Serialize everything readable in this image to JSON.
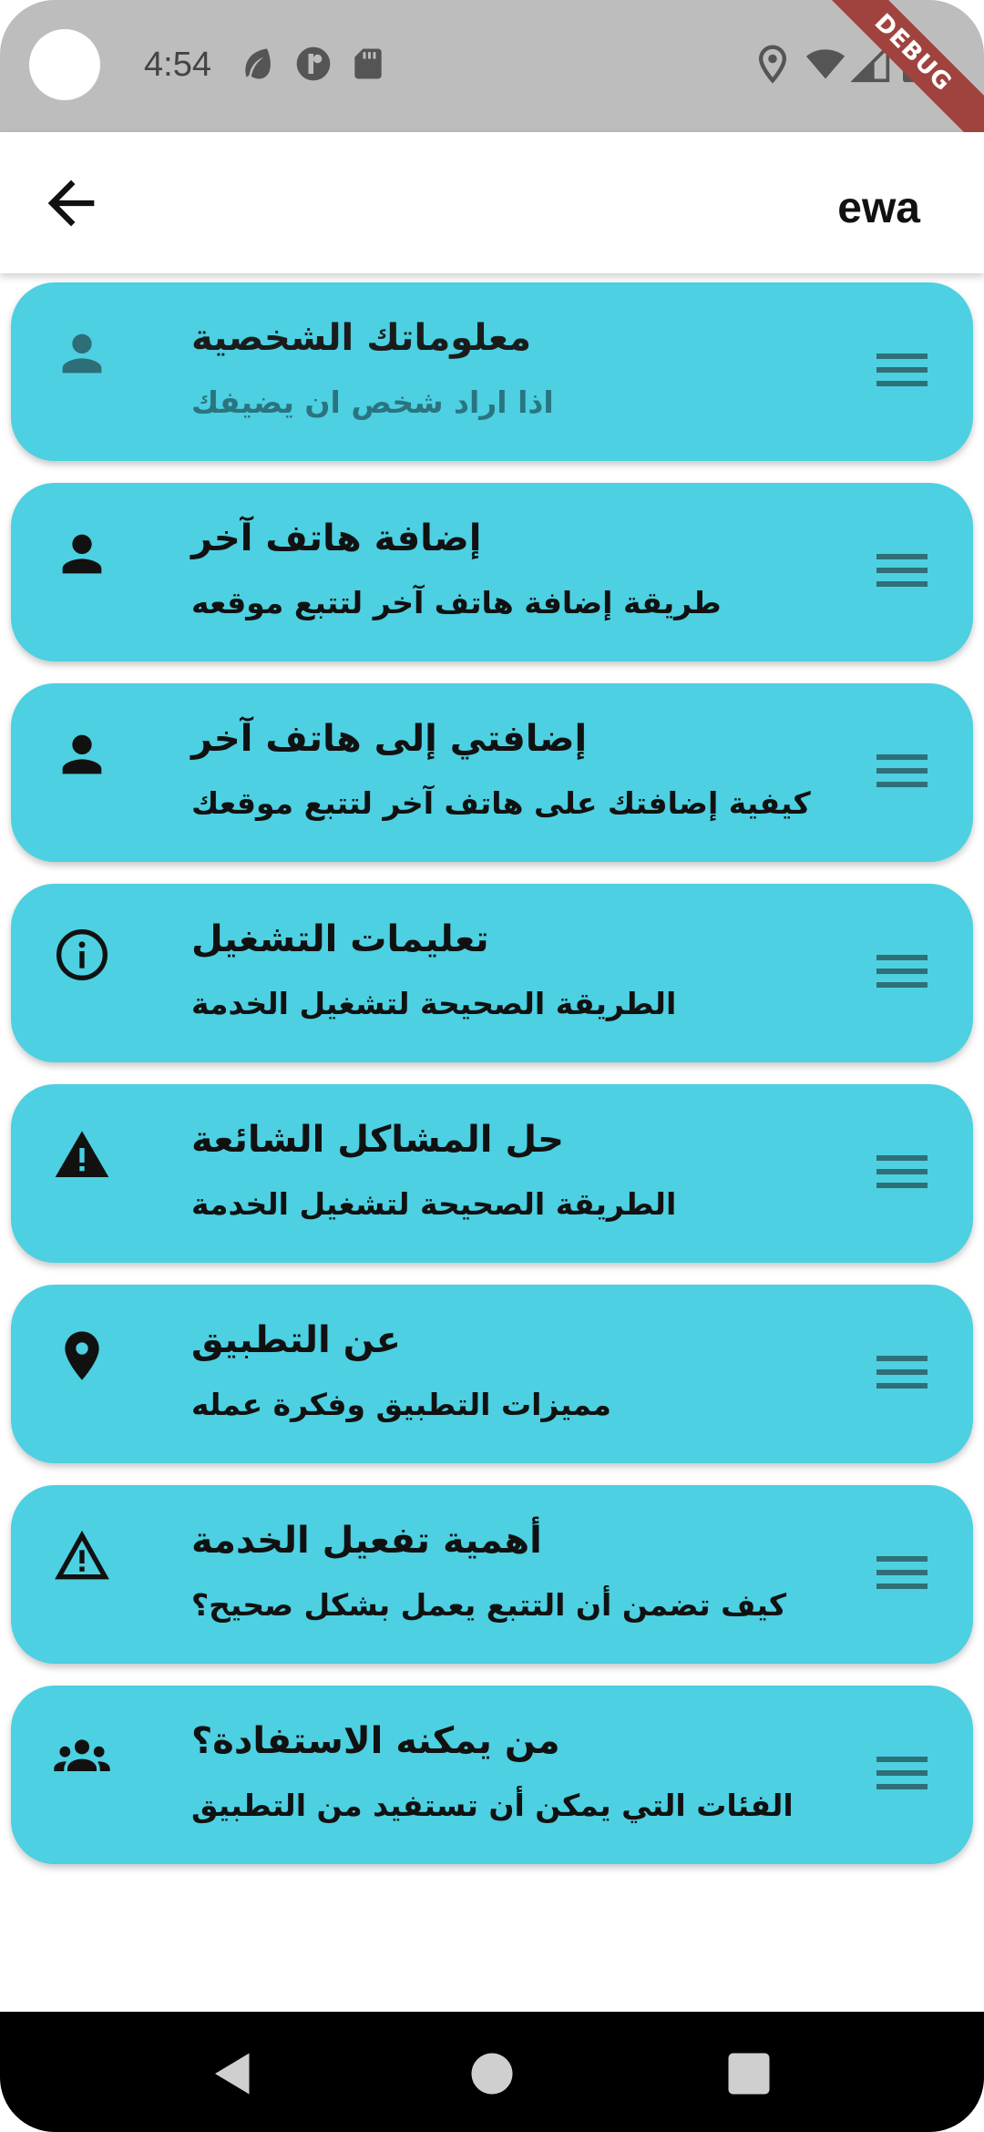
{
  "status_bar": {
    "time": "4:54",
    "debug_label": "DEBUG",
    "left_icons": [
      "leaf-icon",
      "app-circle-icon",
      "sd-card-icon"
    ],
    "right_icons": [
      "location-icon",
      "wifi-icon",
      "signal-icon",
      "battery-icon"
    ]
  },
  "app_bar": {
    "title": "ewa",
    "back_icon": "arrow-back-icon"
  },
  "colors": {
    "card_bg": "#4dd0e1",
    "muted_subtitle": "#2a7480",
    "status_bar_bg": "#bdbdbd",
    "debug_ribbon": "#a0433f"
  },
  "items": [
    {
      "title": "معلوماتك الشخصية",
      "subtitle": "اذا اراد شخص ان يضيفك",
      "icon": "person-icon"
    },
    {
      "title": "إضافة هاتف آخر",
      "subtitle": "طريقة إضافة هاتف آخر لتتبع موقعه",
      "icon": "person-icon"
    },
    {
      "title": "إضافتي إلى هاتف آخر",
      "subtitle": "كيفية إضافتك على هاتف آخر لتتبع موقعك",
      "icon": "person-icon"
    },
    {
      "title": "تعليمات التشغيل",
      "subtitle": "الطريقة الصحيحة لتشغيل الخدمة",
      "icon": "info-icon"
    },
    {
      "title": "حل المشاكل الشائعة",
      "subtitle": "الطريقة الصحيحة لتشغيل الخدمة",
      "icon": "warning-icon"
    },
    {
      "title": "عن التطبيق",
      "subtitle": "مميزات التطبيق وفكرة عمله",
      "icon": "location-pin-icon"
    },
    {
      "title": "أهمية تفعيل الخدمة",
      "subtitle": "كيف تضمن أن التتبع يعمل بشكل صحيح؟",
      "icon": "warning-outline-icon"
    },
    {
      "title": "من يمكنه الاستفادة؟",
      "subtitle": "الفئات التي يمكن أن تستفيد من التطبيق",
      "icon": "group-icon"
    }
  ],
  "nav_bar": {
    "buttons": [
      "back-triangle-icon",
      "home-circle-icon",
      "recents-square-icon"
    ]
  }
}
